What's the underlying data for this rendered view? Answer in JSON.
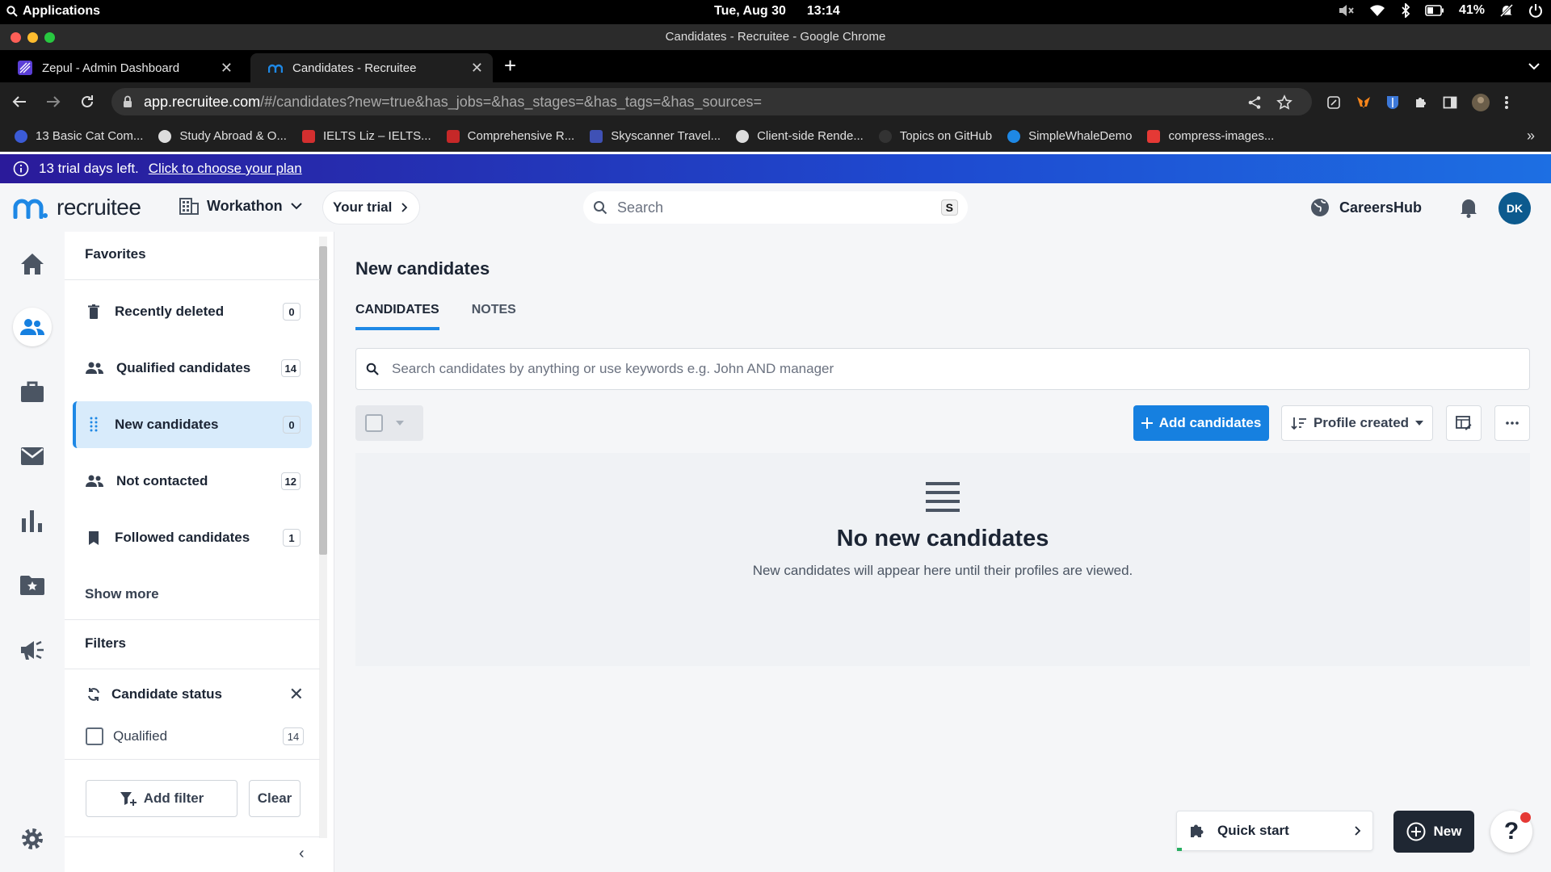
{
  "os": {
    "apps_label": "Applications",
    "date": "Tue, Aug 30",
    "time": "13:14",
    "battery": "41%"
  },
  "browser": {
    "window_title": "Candidates - Recruitee - Google Chrome",
    "tabs": [
      {
        "label": "Zepul - Admin Dashboard"
      },
      {
        "label": "Candidates - Recruitee"
      }
    ],
    "url_host": "app.recruitee.com",
    "url_rest": "/#/candidates?new=true&has_jobs=&has_stages=&has_tags=&has_sources=",
    "bookmarks": [
      {
        "label": "13 Basic Cat Com...",
        "color": "#3b5bd6"
      },
      {
        "label": "Study Abroad & O...",
        "color": "#dddddd"
      },
      {
        "label": "IELTS Liz – IELTS...",
        "color": "#d32f2f"
      },
      {
        "label": "Comprehensive R...",
        "color": "#c62828"
      },
      {
        "label": "Skyscanner Travel...",
        "color": "#3f51b5"
      },
      {
        "label": "Client-side Rende...",
        "color": "#dddddd"
      },
      {
        "label": "Topics on GitHub",
        "color": "#333333"
      },
      {
        "label": "SimpleWhaleDemo",
        "color": "#1e88e5"
      },
      {
        "label": "compress-images...",
        "color": "#e53935"
      }
    ]
  },
  "trial_banner": {
    "text": "13 trial days left.",
    "link": "Click to choose your plan"
  },
  "header": {
    "logo_text": "recruitee",
    "workspace": "Workathon",
    "your_trial": "Your trial",
    "search_placeholder": "Search",
    "search_shortcut": "S",
    "careers_hub": "CareersHub",
    "avatar_initials": "DK"
  },
  "sidebar": {
    "favorites_heading": "Favorites",
    "items": [
      {
        "label": "Recently deleted",
        "count": "0",
        "icon": "trash-icon"
      },
      {
        "label": "Qualified candidates",
        "count": "14",
        "icon": "people-icon"
      },
      {
        "label": "New candidates",
        "count": "0",
        "icon": "drag-handle-icon"
      },
      {
        "label": "Not contacted",
        "count": "12",
        "icon": "people-icon"
      },
      {
        "label": "Followed candidates",
        "count": "1",
        "icon": "bookmark-icon"
      }
    ],
    "show_more": "Show more",
    "filters_heading": "Filters",
    "filter_group": "Candidate status",
    "filter_option": {
      "label": "Qualified",
      "count": "14"
    },
    "add_filter": "Add filter",
    "clear": "Clear"
  },
  "main": {
    "title": "New candidates",
    "tabs": [
      {
        "label": "CANDIDATES"
      },
      {
        "label": "NOTES"
      }
    ],
    "search_placeholder": "Search candidates by anything or use keywords e.g. John AND manager",
    "add_candidates": "Add candidates",
    "sort_label": "Profile created",
    "empty_title": "No new candidates",
    "empty_subtitle": "New candidates will appear here until their profiles are viewed."
  },
  "floating": {
    "quick_start": "Quick start",
    "new": "New",
    "help": "?"
  },
  "colors": {
    "accent": "#1680e0",
    "active_item_bg": "#d8ebfb",
    "banner_start": "#2a1a9a",
    "banner_end": "#1d6fe3"
  }
}
